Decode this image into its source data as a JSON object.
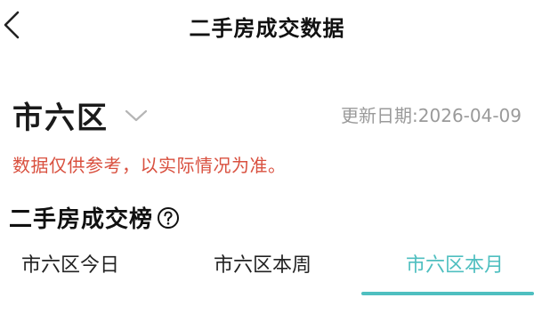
{
  "header": {
    "back_icon": "chevron-left-icon",
    "title": "二手房成交数据"
  },
  "district": {
    "name": "市六区",
    "dropdown_icon": "chevron-down-icon"
  },
  "update_date": "更新日期:2026-04-09",
  "notice": "数据仅供参考，以实际情况为准。",
  "ranking": {
    "title": "二手房成交榜",
    "help_icon": "question-circle-icon"
  },
  "tabs": [
    {
      "label": "市六区今日",
      "active": false
    },
    {
      "label": "市六区本周",
      "active": false
    },
    {
      "label": "市六区本月",
      "active": true
    }
  ],
  "colors": {
    "accent": "#4fbfc0",
    "warning": "#d9503f",
    "muted": "#9a9a9a"
  }
}
